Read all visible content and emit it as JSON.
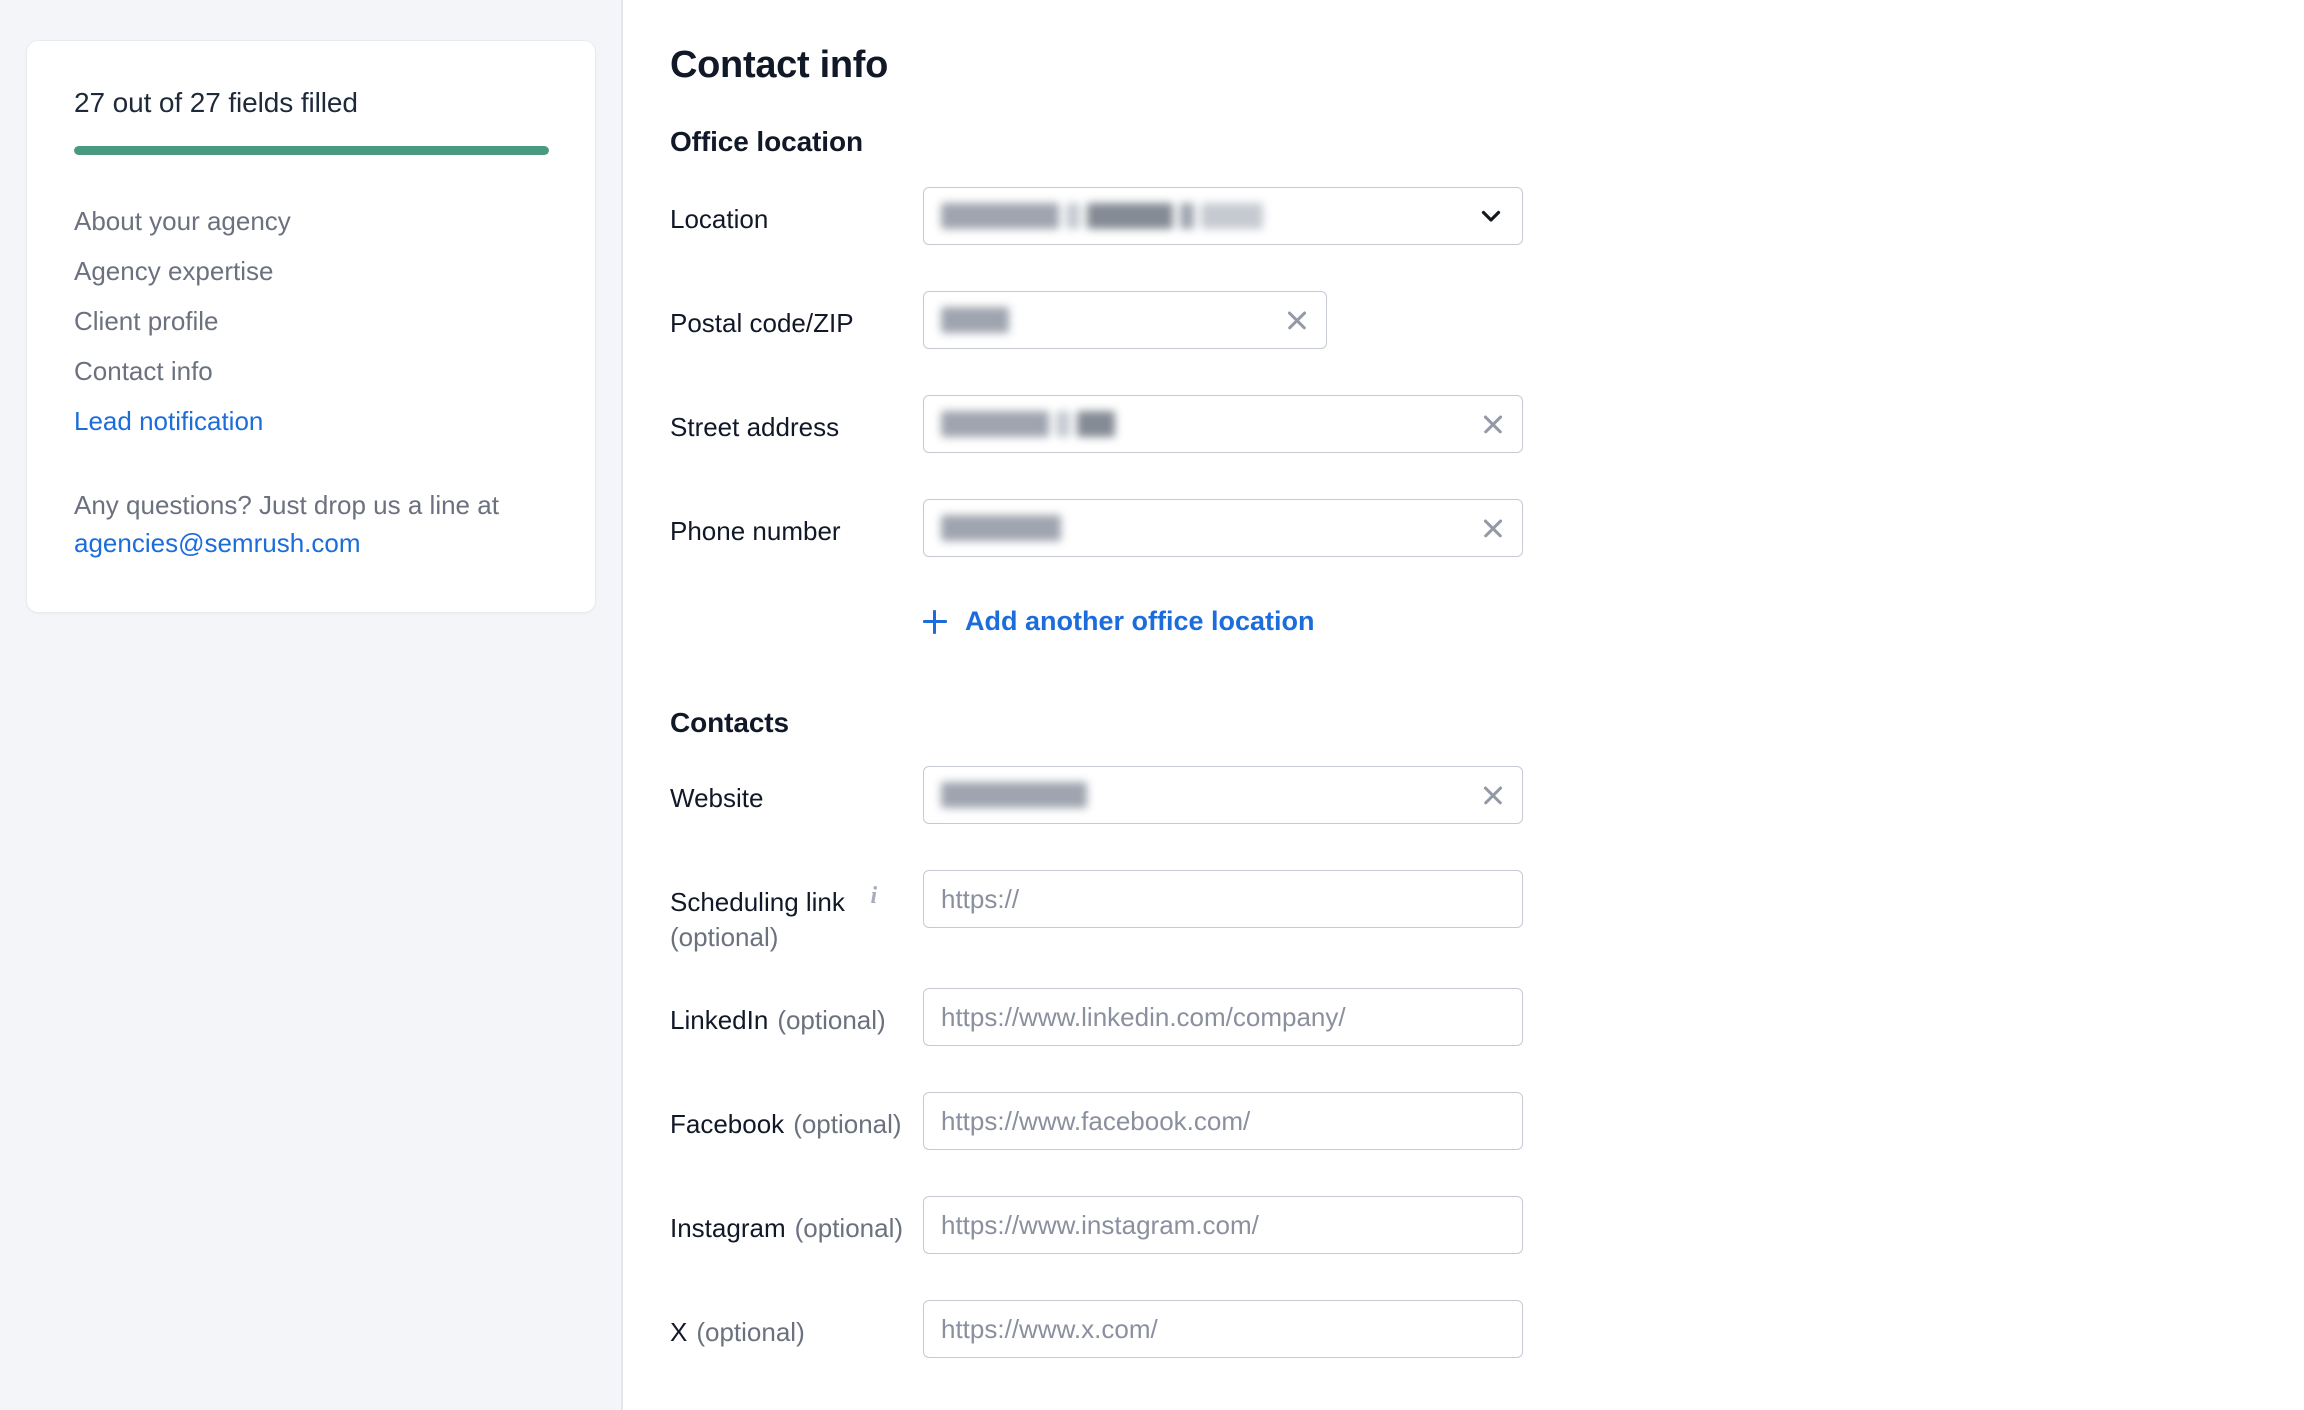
{
  "sidebar": {
    "progress": {
      "label": "27 out of 27 fields filled",
      "filled": 27,
      "total": 27,
      "percent": 100,
      "bar_color": "#4a9a82"
    },
    "nav_items": [
      {
        "label": "About your agency",
        "active": false
      },
      {
        "label": "Agency expertise",
        "active": false
      },
      {
        "label": "Client profile",
        "active": false
      },
      {
        "label": "Contact info",
        "active": false
      },
      {
        "label": "Lead notification",
        "active": true
      }
    ],
    "help": {
      "text_before": "Any questions? Just drop us a line at ",
      "email": "agencies@semrush.com"
    }
  },
  "main": {
    "page_title": "Contact info",
    "office_section": {
      "heading": "Office location",
      "fields": [
        {
          "label": "Location",
          "type": "select",
          "value_redacted": true,
          "redacted_pattern": [
            118,
            14,
            86,
            14,
            62
          ],
          "placeholder": "",
          "icon": "chevron-down-icon",
          "width": "wide"
        },
        {
          "label": "Postal code/ZIP",
          "type": "text",
          "value_redacted": true,
          "redacted_pattern": [
            68
          ],
          "placeholder": "",
          "icon": "clear-icon",
          "width": "narrow"
        },
        {
          "label": "Street address",
          "type": "text",
          "value_redacted": true,
          "redacted_pattern": [
            108,
            14,
            38
          ],
          "placeholder": "",
          "icon": "clear-icon",
          "width": "wide"
        },
        {
          "label": "Phone number",
          "type": "text",
          "value_redacted": true,
          "redacted_pattern": [
            120
          ],
          "placeholder": "",
          "icon": "clear-icon",
          "width": "wide"
        }
      ],
      "add_link": "Add another office location"
    },
    "contacts_section": {
      "heading": "Contacts",
      "fields": [
        {
          "label": "Website",
          "optional": "",
          "type": "text",
          "value_redacted": true,
          "redacted_pattern": [
            146
          ],
          "placeholder": "",
          "icon": "clear-icon",
          "width": "wide"
        },
        {
          "label": "Scheduling link",
          "label_line2": "(optional)",
          "optional": "",
          "info_icon": true,
          "type": "text",
          "value_redacted": false,
          "placeholder": "https://",
          "icon": "",
          "width": "wide"
        },
        {
          "label": "LinkedIn",
          "optional": "(optional)",
          "type": "text",
          "value_redacted": false,
          "placeholder": "https://www.linkedin.com/company/",
          "icon": "",
          "width": "wide"
        },
        {
          "label": "Facebook",
          "optional": "(optional)",
          "type": "text",
          "value_redacted": false,
          "placeholder": "https://www.facebook.com/",
          "icon": "",
          "width": "wide"
        },
        {
          "label": "Instagram",
          "optional": "(optional)",
          "type": "text",
          "value_redacted": false,
          "placeholder": "https://www.instagram.com/",
          "icon": "",
          "width": "wide"
        },
        {
          "label": "X",
          "optional": "(optional)",
          "type": "text",
          "value_redacted": false,
          "placeholder": "https://www.x.com/",
          "icon": "",
          "width": "wide"
        }
      ]
    }
  },
  "colors": {
    "link": "#1c6ddb",
    "progress": "#4a9a82",
    "sidebar_bg": "#f4f5f9",
    "border": "#c6cad3",
    "text": "#111827",
    "muted": "#6b717f"
  }
}
